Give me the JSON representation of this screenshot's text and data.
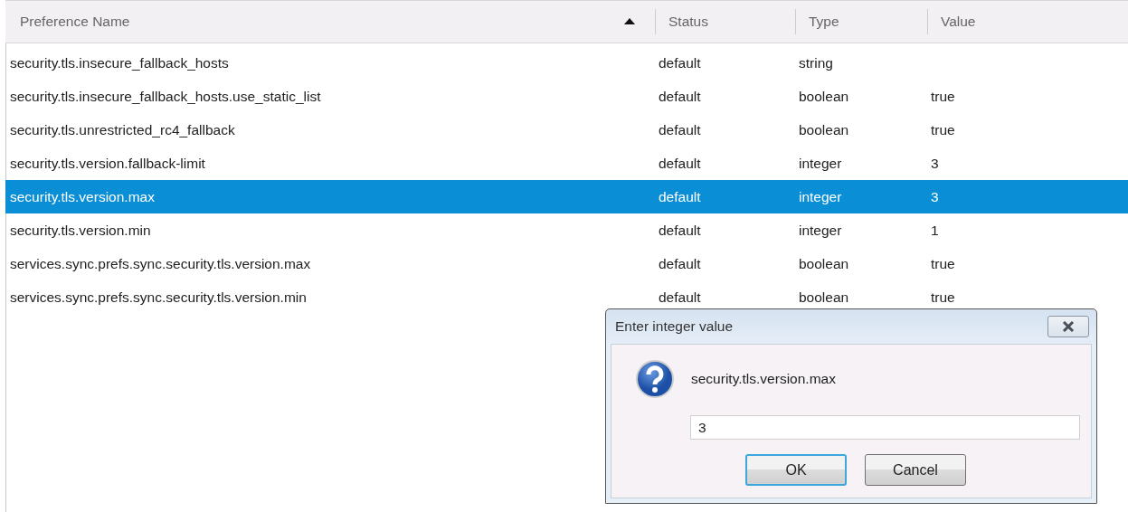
{
  "table": {
    "columns": [
      {
        "label": "Preference Name",
        "sorted": true
      },
      {
        "label": "Status",
        "sorted": false
      },
      {
        "label": "Type",
        "sorted": false
      },
      {
        "label": "Value",
        "sorted": false
      }
    ],
    "rows": [
      {
        "name": "security.tls.insecure_fallback_hosts",
        "status": "default",
        "type": "string",
        "value": "",
        "selected": false
      },
      {
        "name": "security.tls.insecure_fallback_hosts.use_static_list",
        "status": "default",
        "type": "boolean",
        "value": "true",
        "selected": false
      },
      {
        "name": "security.tls.unrestricted_rc4_fallback",
        "status": "default",
        "type": "boolean",
        "value": "true",
        "selected": false
      },
      {
        "name": "security.tls.version.fallback-limit",
        "status": "default",
        "type": "integer",
        "value": "3",
        "selected": false
      },
      {
        "name": "security.tls.version.max",
        "status": "default",
        "type": "integer",
        "value": "3",
        "selected": true
      },
      {
        "name": "security.tls.version.min",
        "status": "default",
        "type": "integer",
        "value": "1",
        "selected": false
      },
      {
        "name": "services.sync.prefs.sync.security.tls.version.max",
        "status": "default",
        "type": "boolean",
        "value": "true",
        "selected": false
      },
      {
        "name": "services.sync.prefs.sync.security.tls.version.min",
        "status": "default",
        "type": "boolean",
        "value": "true",
        "selected": false
      }
    ]
  },
  "dialog": {
    "title": "Enter integer value",
    "message": "security.tls.version.max",
    "value": "3",
    "buttons": [
      {
        "label": "OK",
        "focused": true
      },
      {
        "label": "Cancel",
        "focused": false
      }
    ]
  }
}
